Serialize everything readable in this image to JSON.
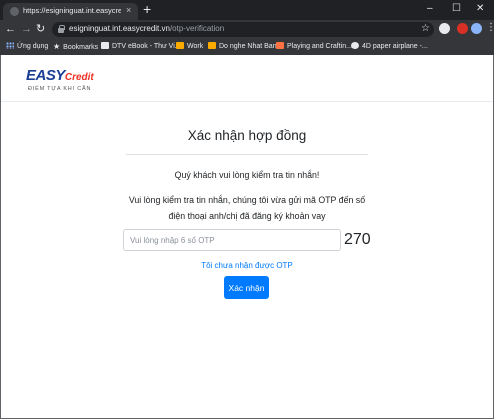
{
  "browser": {
    "tab_title": "https://esigninguat.int.easycredit",
    "tab_close": "×",
    "new_tab": "+",
    "window_controls": {
      "minimize": "–",
      "maximize": "☐",
      "close": "✕"
    },
    "nav": {
      "back": "←",
      "forward": "→",
      "reload": "↻"
    },
    "url_host": "esigninguat.int.easycredit.vn",
    "url_path": "/otp-verification",
    "star_icon": "star-icon",
    "menu_icon": "⋮"
  },
  "bookmarks": [
    {
      "label": "Ứng dụng",
      "icon": "apps-grid-icon"
    },
    {
      "label": "Bookmarks",
      "icon": "star-icon"
    },
    {
      "label": "DTV eBook - Thư Vi...",
      "icon": "document-icon"
    },
    {
      "label": "Work",
      "icon": "folder-icon"
    },
    {
      "label": "Do nghe Nhat Ban",
      "icon": "folder-icon"
    },
    {
      "label": "Playing and Craftin...",
      "icon": "blogger-icon"
    },
    {
      "label": "4D paper airplane -...",
      "icon": "globe-icon"
    }
  ],
  "logo": {
    "easy": "EASY",
    "credit": "Credit",
    "slogan": "ĐIỂM TỰA KHI CẦN",
    "colors": {
      "primary": "#1a3f94",
      "accent": "#ee3124"
    }
  },
  "page": {
    "title": "Xác nhận hợp đồng",
    "notice": "Quý khách vui lòng kiểm tra tin nhắn!",
    "instruction": "Vui lòng kiểm tra tin nhắn, chúng tôi vừa gửi mã OTP đến số điện thoại anh/chị đã đăng ký khoản vay",
    "otp_placeholder": "Vui lòng nhập 6 số OTP",
    "otp_value": "",
    "countdown": "270",
    "resend_link": "Tôi chưa nhận được OTP",
    "confirm_button": "Xác nhận",
    "accent_color": "#007bff"
  }
}
